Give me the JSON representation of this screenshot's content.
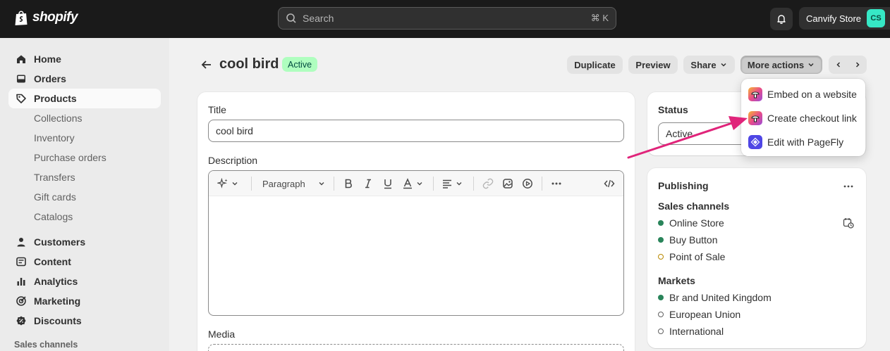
{
  "topbar": {
    "logo_text": "shopify",
    "search_placeholder": "Search",
    "search_shortcut": "⌘ K",
    "store_name": "Canvify Store",
    "store_initials": "CS"
  },
  "sidebar": {
    "items": [
      {
        "label": "Home",
        "icon": "home-icon"
      },
      {
        "label": "Orders",
        "icon": "inbox-icon"
      },
      {
        "label": "Products",
        "icon": "tag-icon",
        "active": true
      }
    ],
    "product_subitems": [
      "Collections",
      "Inventory",
      "Purchase orders",
      "Transfers",
      "Gift cards",
      "Catalogs"
    ],
    "more_items": [
      {
        "label": "Customers",
        "icon": "person-icon"
      },
      {
        "label": "Content",
        "icon": "content-icon"
      },
      {
        "label": "Analytics",
        "icon": "analytics-icon"
      },
      {
        "label": "Marketing",
        "icon": "target-icon"
      },
      {
        "label": "Discounts",
        "icon": "discount-icon"
      }
    ],
    "section_label": "Sales channels"
  },
  "header": {
    "title": "cool bird",
    "status_badge": "Active",
    "buttons": {
      "duplicate": "Duplicate",
      "preview": "Preview",
      "share": "Share",
      "more_actions": "More actions"
    }
  },
  "product_form": {
    "title_label": "Title",
    "title_value": "cool bird",
    "description_label": "Description",
    "paragraph_select": "Paragraph",
    "media_label": "Media"
  },
  "status_card": {
    "heading": "Status",
    "value": "Active"
  },
  "publishing": {
    "heading": "Publishing",
    "sales_channels_label": "Sales channels",
    "sales_channels": [
      {
        "name": "Online Store",
        "state": "active"
      },
      {
        "name": "Buy Button",
        "state": "active"
      },
      {
        "name": "Point of Sale",
        "state": "inactive"
      }
    ],
    "markets_label": "Markets",
    "markets": [
      {
        "name": "Br and United Kingdom",
        "state": "active"
      },
      {
        "name": "European Union",
        "state": "inactive"
      },
      {
        "name": "International",
        "state": "inactive"
      }
    ]
  },
  "more_actions_menu": {
    "items": [
      {
        "label": "Embed on a website",
        "icon": "mushroom-app-icon"
      },
      {
        "label": "Create checkout link",
        "icon": "mushroom-app-icon"
      },
      {
        "label": "Edit with PageFly",
        "icon": "pagefly-icon"
      }
    ]
  },
  "colors": {
    "topbar_bg": "#1a1a1a",
    "active_badge_bg": "#affebf",
    "annotation_arrow": "#e0247a",
    "channel_active": "#29845a"
  }
}
